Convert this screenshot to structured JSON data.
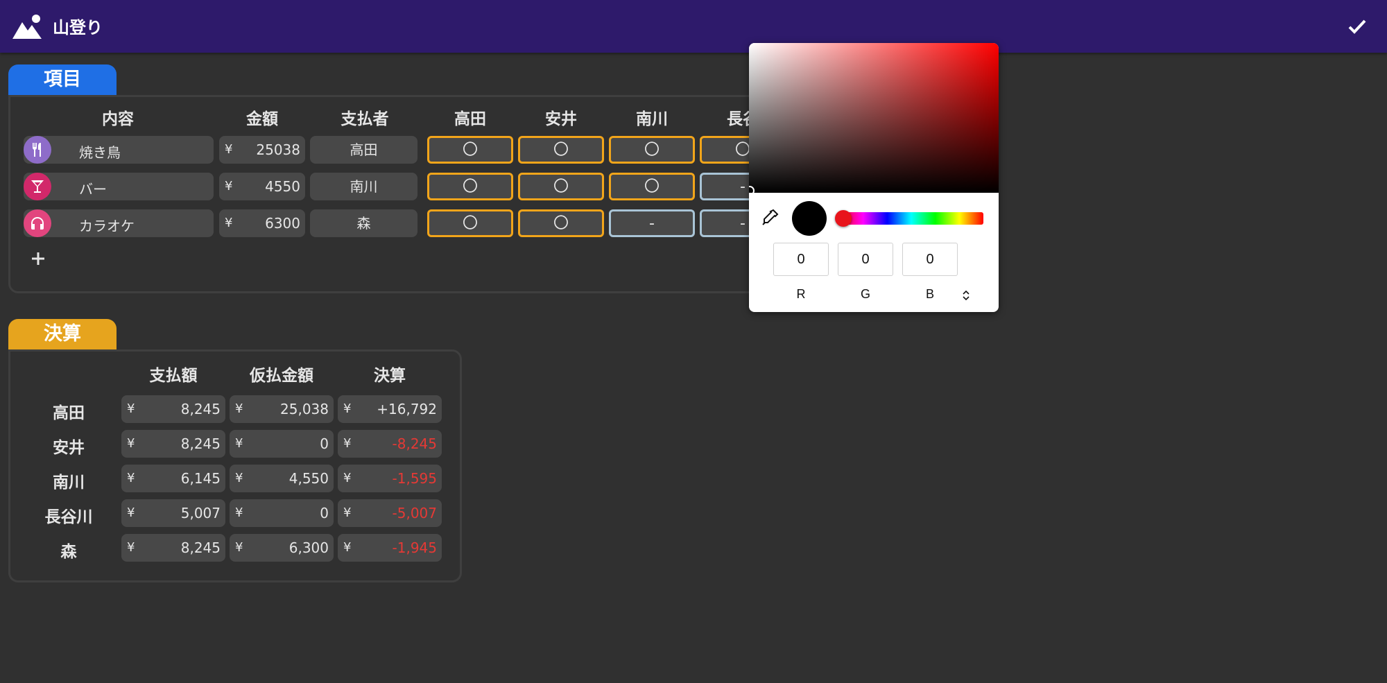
{
  "app": {
    "title": "山登り",
    "colors": {
      "header": "#2e1a6b",
      "items_tab": "#1f6fe5",
      "settle_tab": "#e6a41e",
      "check_on": "#f2a51a",
      "check_off": "#a9c4d6",
      "negative": "#e53935"
    }
  },
  "items_section": {
    "tab_label": "項目",
    "headers": {
      "content": "内容",
      "amount": "金額",
      "payer": "支払者"
    },
    "participants": [
      "高田",
      "安井",
      "南川",
      "長谷"
    ],
    "rows": [
      {
        "icon": "fork-knife-icon",
        "icon_color": "#8e6cc9",
        "name": "焼き鳥",
        "currency": "¥",
        "amount": "25038",
        "payer": "高田",
        "marks": [
          "〇",
          "〇",
          "〇",
          "〇"
        ]
      },
      {
        "icon": "cocktail-icon",
        "icon_color": "#d2286a",
        "name": "バー",
        "currency": "¥",
        "amount": "4550",
        "payer": "南川",
        "marks": [
          "〇",
          "〇",
          "〇",
          "-"
        ]
      },
      {
        "icon": "headphones-icon",
        "icon_color": "#e2457e",
        "name": "カラオケ",
        "currency": "¥",
        "amount": "6300",
        "payer": "森",
        "marks": [
          "〇",
          "〇",
          "-",
          "-"
        ]
      }
    ],
    "add_label": "+"
  },
  "settlement_section": {
    "tab_label": "決算",
    "headers": {
      "paid": "支払額",
      "advance": "仮払金額",
      "settle": "決算"
    },
    "currency": "¥",
    "rows": [
      {
        "name": "高田",
        "paid": "8,245",
        "advance": "25,038",
        "settle": "+16,792",
        "negative": false
      },
      {
        "name": "安井",
        "paid": "8,245",
        "advance": "0",
        "settle": "-8,245",
        "negative": true
      },
      {
        "name": "南川",
        "paid": "6,145",
        "advance": "4,550",
        "settle": "-1,595",
        "negative": true
      },
      {
        "name": "長谷川",
        "paid": "5,007",
        "advance": "0",
        "settle": "-5,007",
        "negative": true
      },
      {
        "name": "森",
        "paid": "8,245",
        "advance": "6,300",
        "settle": "-1,945",
        "negative": true
      }
    ]
  },
  "color_picker": {
    "current_color": "#000000",
    "hue_color": "#ff0000",
    "r": "0",
    "g": "0",
    "b": "0",
    "labels": {
      "r": "R",
      "g": "G",
      "b": "B"
    }
  }
}
